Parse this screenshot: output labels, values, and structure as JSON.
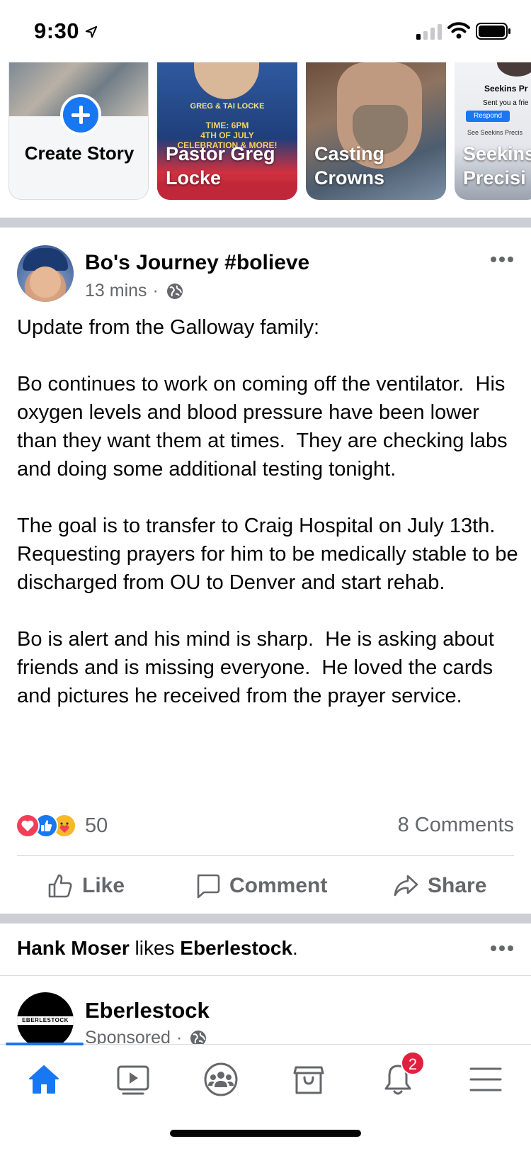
{
  "status_bar": {
    "time": "9:30"
  },
  "stories": [
    {
      "label": "Create Story",
      "type": "create"
    },
    {
      "label": "Pastor Greg Locke",
      "graphic_lines": [
        "GREG & TAI LOCKE",
        "TIME: 6PM",
        "4TH OF JULY",
        "CELEBRATION & MORE!"
      ]
    },
    {
      "label": "Casting Crowns"
    },
    {
      "label": "Seekins Precisi",
      "graphic_lines": [
        "Seekins Pr",
        "Sent you a frie",
        "Respond",
        "See Seekins Precis"
      ]
    }
  ],
  "post": {
    "author": "Bo's Journey #bolieve",
    "time": "13 mins",
    "dot": "·",
    "body": "Update from the Galloway family:\n\nBo continues to work on coming off the ventilator.  His oxygen levels and blood pressure have been lower than they want them at times.  They are checking labs and doing some additional testing tonight.\n\nThe goal is to transfer to Craig Hospital on July 13th.  Requesting prayers for him to be medically stable to be discharged from OU to Denver and start rehab.\n\nBo is alert and his mind is sharp.  He is asking about friends and is missing everyone.  He loved the cards and pictures he received from the prayer service.",
    "reaction_count": "50",
    "comments": "8 Comments",
    "actions": {
      "like": "Like",
      "comment": "Comment",
      "share": "Share"
    }
  },
  "liked_by": {
    "user": "Hank Moser",
    "verb": " likes ",
    "page": "Eberlestock",
    "end": "."
  },
  "ad": {
    "name": "Eberlestock",
    "logo_text": "EBERLESTOCK",
    "meta": "Sponsored",
    "dot": "·"
  },
  "tab_bar": {
    "notification_badge": "2",
    "active_tab": "home",
    "tabs": [
      "home",
      "watch",
      "groups",
      "marketplace",
      "notifications",
      "menu"
    ]
  },
  "colors": {
    "accent": "#1877f2",
    "secondary_text": "#65676b",
    "badge": "#e41e3f",
    "divider": "#ccced3"
  }
}
